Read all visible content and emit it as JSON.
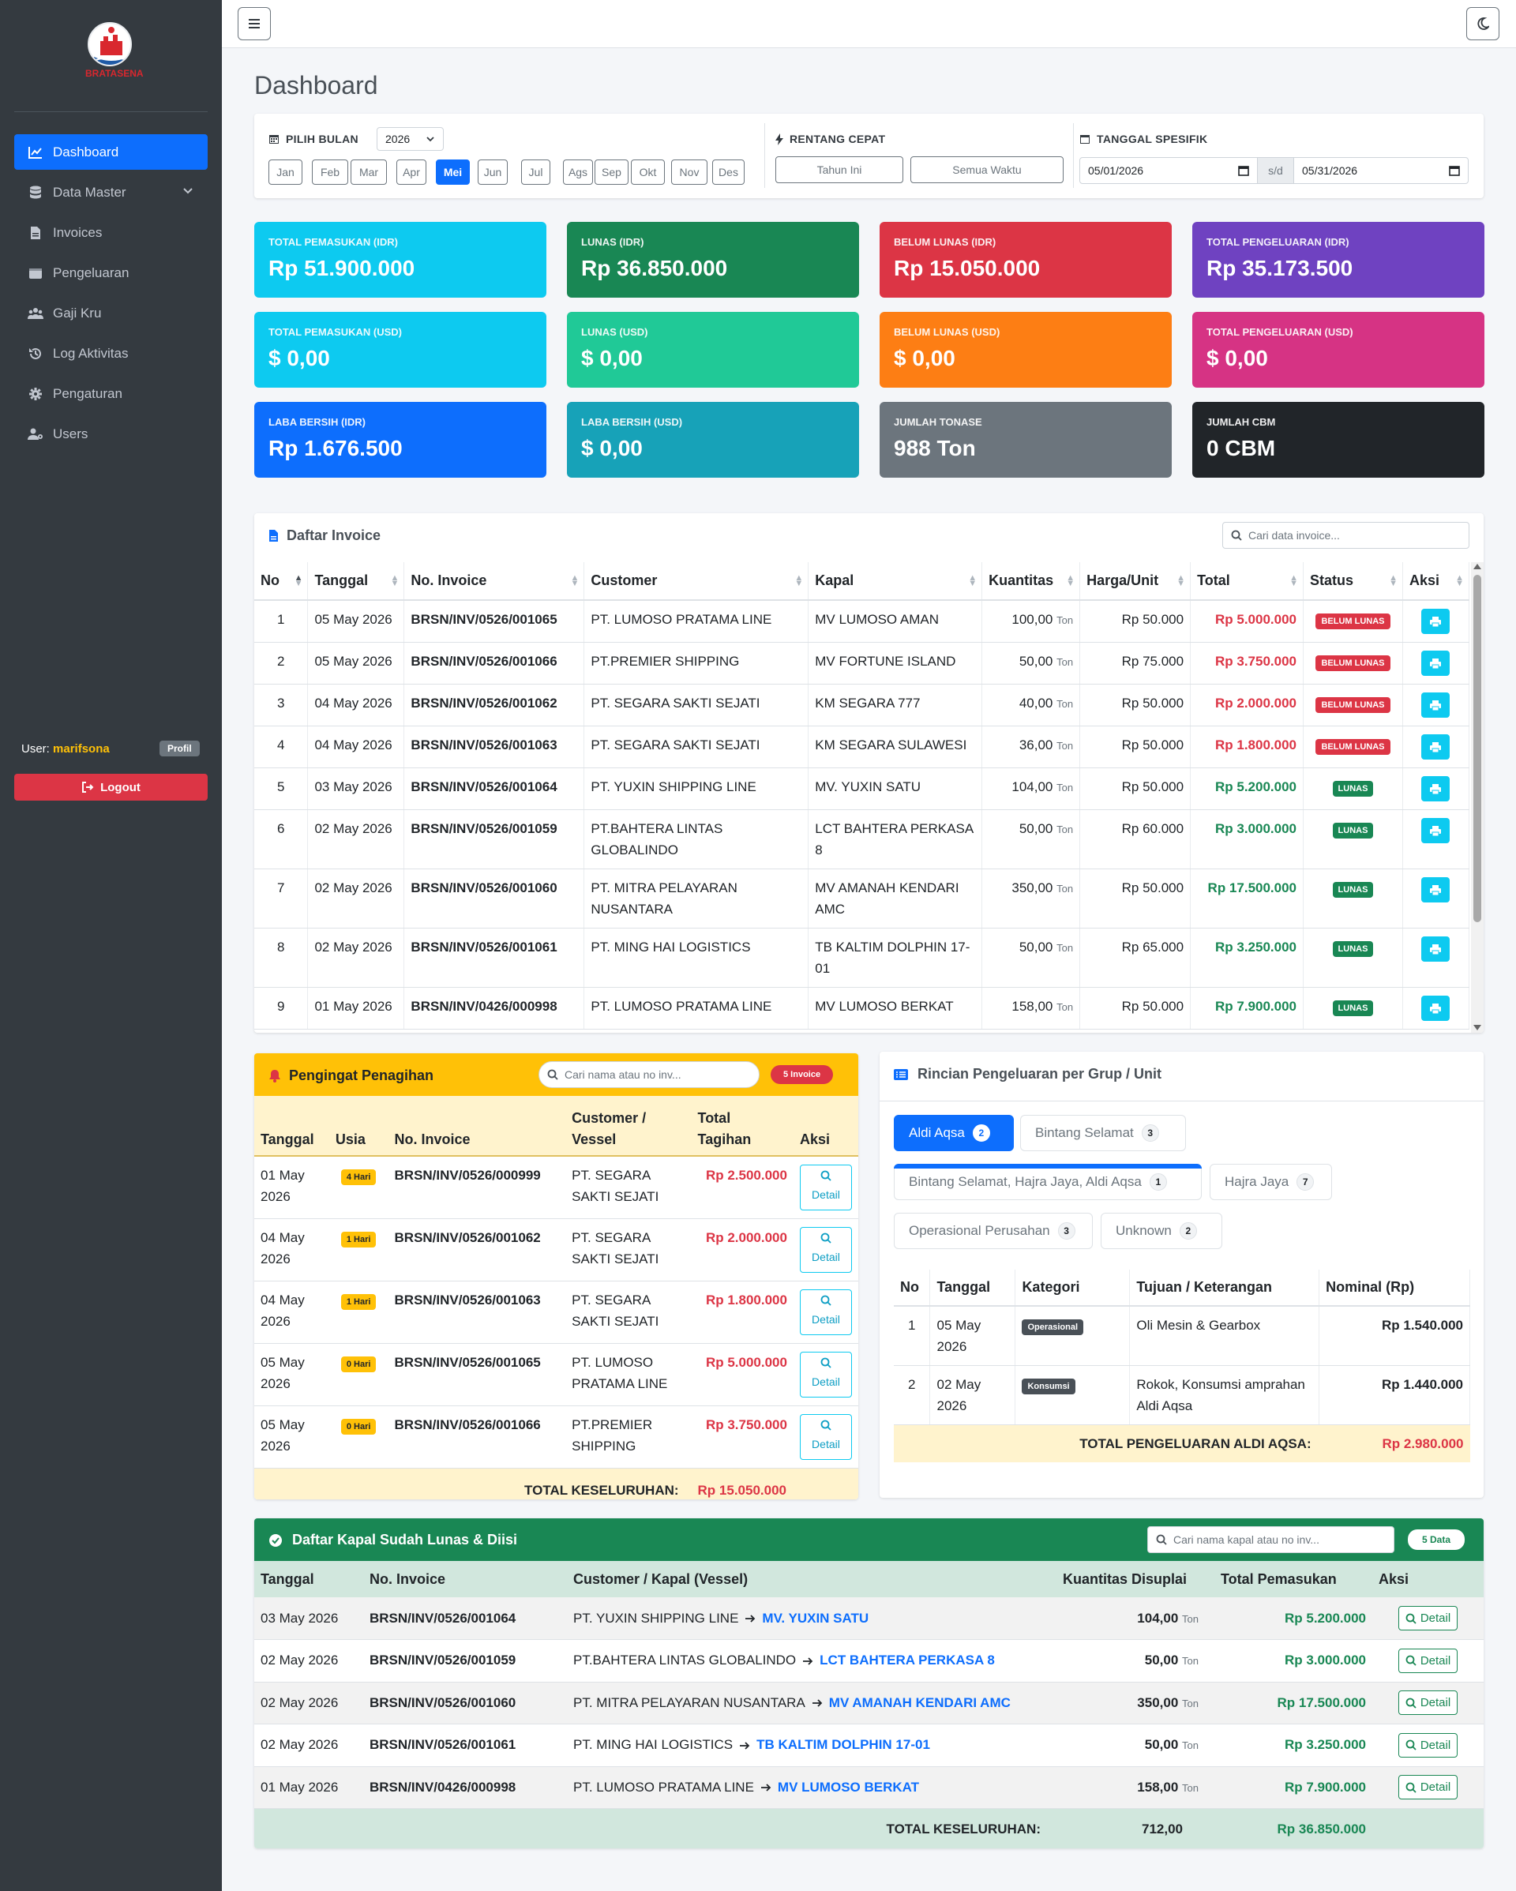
{
  "sidebar": {
    "brand": "BRATASENA",
    "menu": [
      {
        "label": "Dashboard",
        "icon": "chart-line-icon",
        "active": true
      },
      {
        "label": "Data Master",
        "icon": "database-icon",
        "has_children": true
      },
      {
        "label": "Invoices",
        "icon": "file-invoice-icon"
      },
      {
        "label": "Pengeluaran",
        "icon": "wallet-icon"
      },
      {
        "label": "Gaji Kru",
        "icon": "users-icon"
      },
      {
        "label": "Log Aktivitas",
        "icon": "history-icon"
      },
      {
        "label": "Pengaturan",
        "icon": "gear-icon"
      },
      {
        "label": "Users",
        "icon": "user-gear-icon"
      }
    ],
    "user_prefix": "User:",
    "user_name": "marifsona",
    "profile_label": "Profil",
    "logout_label": "Logout"
  },
  "page": {
    "title": "Dashboard"
  },
  "filter": {
    "month_label": "PILIH BULAN",
    "year": "2026",
    "months": [
      "Jan",
      "Feb",
      "Mar",
      "Apr",
      "Mei",
      "Jun",
      "Jul",
      "Ags",
      "Sep",
      "Okt",
      "Nov",
      "Des"
    ],
    "active_month": "Mei",
    "quick_label": "RENTANG CEPAT",
    "quick_this_year": "Tahun Ini",
    "quick_all": "Semua Waktu",
    "date_label": "TANGGAL SPESIFIK",
    "date_from": "05/01/2026",
    "date_sep": "s/d",
    "date_to": "05/31/2026"
  },
  "stats": [
    {
      "label": "TOTAL PEMASUKAN (IDR)",
      "value": "Rp 51.900.000",
      "color": "#0dcaf0"
    },
    {
      "label": "LUNAS (IDR)",
      "value": "Rp 36.850.000",
      "color": "#198754"
    },
    {
      "label": "BELUM LUNAS (IDR)",
      "value": "Rp 15.050.000",
      "color": "#dc3545"
    },
    {
      "label": "TOTAL PENGELUARAN (IDR)",
      "value": "Rp 35.173.500",
      "color": "#6f42c1"
    },
    {
      "label": "TOTAL PEMASUKAN (USD)",
      "value": "$ 0,00",
      "color": "#0dcaf0"
    },
    {
      "label": "LUNAS (USD)",
      "value": "$ 0,00",
      "color": "#20c997"
    },
    {
      "label": "BELUM LUNAS (USD)",
      "value": "$ 0,00",
      "color": "#fd7e14"
    },
    {
      "label": "TOTAL PENGELUARAN (USD)",
      "value": "$ 0,00",
      "color": "#d63384"
    },
    {
      "label": "LABA BERSIH (IDR)",
      "value": "Rp 1.676.500",
      "color": "#0d6efd"
    },
    {
      "label": "LABA BERSIH (USD)",
      "value": "$ 0,00",
      "color": "#17a2b8"
    },
    {
      "label": "JUMLAH TONASE",
      "value": "988 Ton",
      "color": "#6c757d"
    },
    {
      "label": "JUMLAH CBM",
      "value": "0 CBM",
      "color": "#212529"
    }
  ],
  "invoices": {
    "title": "Daftar Invoice",
    "search_placeholder": "Cari data invoice...",
    "columns": [
      "No",
      "Tanggal",
      "No. Invoice",
      "Customer",
      "Kapal",
      "Kuantitas",
      "Harga/Unit",
      "Total",
      "Status",
      "Aksi"
    ],
    "rows": [
      {
        "no": "1",
        "date": "05 May 2026",
        "inv": "BRSN/INV/0526/001065",
        "customer": "PT. LUMOSO PRATAMA LINE",
        "ship": "MV LUMOSO AMAN",
        "qty": "100,00",
        "unit": "Ton",
        "price": "Rp 50.000",
        "total": "Rp 5.000.000",
        "status": "BELUM LUNAS",
        "paid": false
      },
      {
        "no": "2",
        "date": "05 May 2026",
        "inv": "BRSN/INV/0526/001066",
        "customer": "PT.PREMIER SHIPPING",
        "ship": "MV FORTUNE ISLAND",
        "qty": "50,00",
        "unit": "Ton",
        "price": "Rp 75.000",
        "total": "Rp 3.750.000",
        "status": "BELUM LUNAS",
        "paid": false
      },
      {
        "no": "3",
        "date": "04 May 2026",
        "inv": "BRSN/INV/0526/001062",
        "customer": "PT. SEGARA SAKTI SEJATI",
        "ship": "KM SEGARA 777",
        "qty": "40,00",
        "unit": "Ton",
        "price": "Rp 50.000",
        "total": "Rp 2.000.000",
        "status": "BELUM LUNAS",
        "paid": false
      },
      {
        "no": "4",
        "date": "04 May 2026",
        "inv": "BRSN/INV/0526/001063",
        "customer": "PT. SEGARA SAKTI SEJATI",
        "ship": "KM SEGARA SULAWESI",
        "qty": "36,00",
        "unit": "Ton",
        "price": "Rp 50.000",
        "total": "Rp 1.800.000",
        "status": "BELUM LUNAS",
        "paid": false
      },
      {
        "no": "5",
        "date": "03 May 2026",
        "inv": "BRSN/INV/0526/001064",
        "customer": "PT. YUXIN SHIPPING LINE",
        "ship": "MV. YUXIN SATU",
        "qty": "104,00",
        "unit": "Ton",
        "price": "Rp 50.000",
        "total": "Rp 5.200.000",
        "status": "LUNAS",
        "paid": true
      },
      {
        "no": "6",
        "date": "02 May 2026",
        "inv": "BRSN/INV/0526/001059",
        "customer": "PT.BAHTERA LINTAS GLOBALINDO",
        "ship": "LCT BAHTERA PERKASA 8",
        "qty": "50,00",
        "unit": "Ton",
        "price": "Rp 60.000",
        "total": "Rp 3.000.000",
        "status": "LUNAS",
        "paid": true
      },
      {
        "no": "7",
        "date": "02 May 2026",
        "inv": "BRSN/INV/0526/001060",
        "customer": "PT. MITRA PELAYARAN NUSANTARA",
        "ship": "MV AMANAH KENDARI AMC",
        "qty": "350,00",
        "unit": "Ton",
        "price": "Rp 50.000",
        "total": "Rp 17.500.000",
        "status": "LUNAS",
        "paid": true
      },
      {
        "no": "8",
        "date": "02 May 2026",
        "inv": "BRSN/INV/0526/001061",
        "customer": "PT. MING HAI LOGISTICS",
        "ship": "TB KALTIM DOLPHIN 17-01",
        "qty": "50,00",
        "unit": "Ton",
        "price": "Rp 65.000",
        "total": "Rp 3.250.000",
        "status": "LUNAS",
        "paid": true
      },
      {
        "no": "9",
        "date": "01 May 2026",
        "inv": "BRSN/INV/0426/000998",
        "customer": "PT. LUMOSO PRATAMA LINE",
        "ship": "MV LUMOSO BERKAT",
        "qty": "158,00",
        "unit": "Ton",
        "price": "Rp 50.000",
        "total": "Rp 7.900.000",
        "status": "LUNAS",
        "paid": true
      }
    ]
  },
  "reminder": {
    "title": "Pengingat Penagihan",
    "search_placeholder": "Cari nama atau no inv...",
    "count_badge": "5 Invoice",
    "columns": [
      "Tanggal",
      "Usia",
      "No. Invoice",
      "Customer / Vessel",
      "Total Tagihan",
      "Aksi"
    ],
    "rows": [
      {
        "date": "01 May 2026",
        "age": "4 Hari",
        "inv": "BRSN/INV/0526/000999",
        "customer": "PT. SEGARA SAKTI SEJATI",
        "total": "Rp 2.500.000",
        "action": "Detail"
      },
      {
        "date": "04 May 2026",
        "age": "1 Hari",
        "inv": "BRSN/INV/0526/001062",
        "customer": "PT. SEGARA SAKTI SEJATI",
        "total": "Rp 2.000.000",
        "action": "Detail"
      },
      {
        "date": "04 May 2026",
        "age": "1 Hari",
        "inv": "BRSN/INV/0526/001063",
        "customer": "PT. SEGARA SAKTI SEJATI",
        "total": "Rp 1.800.000",
        "action": "Detail"
      },
      {
        "date": "05 May 2026",
        "age": "0 Hari",
        "inv": "BRSN/INV/0526/001065",
        "customer": "PT. LUMOSO PRATAMA LINE",
        "total": "Rp 5.000.000",
        "action": "Detail"
      },
      {
        "date": "05 May 2026",
        "age": "0 Hari",
        "inv": "BRSN/INV/0526/001066",
        "customer": "PT.PREMIER SHIPPING",
        "total": "Rp 3.750.000",
        "action": "Detail"
      }
    ],
    "total_label": "TOTAL KESELURUHAN:",
    "total_value": "Rp 15.050.000"
  },
  "expenses": {
    "title": "Rincian Pengeluaran per Grup / Unit",
    "tabs": [
      {
        "label": "Aldi Aqsa",
        "count": "2",
        "active": true
      },
      {
        "label": "Bintang Selamat",
        "count": "3"
      },
      {
        "label": "Bintang Selamat, Hajra Jaya, Aldi Aqsa",
        "count": "1"
      },
      {
        "label": "Hajra Jaya",
        "count": "7"
      },
      {
        "label": "Operasional Perusahan",
        "count": "3"
      },
      {
        "label": "Unknown",
        "count": "2"
      }
    ],
    "columns": [
      "No",
      "Tanggal",
      "Kategori",
      "Tujuan / Keterangan",
      "Nominal (Rp)"
    ],
    "rows": [
      {
        "no": "1",
        "date": "05 May 2026",
        "category": "Operasional",
        "desc": "Oli Mesin & Gearbox",
        "amount": "Rp 1.540.000"
      },
      {
        "no": "2",
        "date": "02 May 2026",
        "category": "Konsumsi",
        "desc": "Rokok, Konsumsi amprahan Aldi Aqsa",
        "amount": "Rp 1.440.000"
      }
    ],
    "total_label": "TOTAL PENGELUARAN ALDI AQSA:",
    "total_value": "Rp 2.980.000"
  },
  "paid_ships": {
    "title": "Daftar Kapal Sudah Lunas & Diisi",
    "search_placeholder": "Cari nama kapal atau no inv...",
    "count_badge": "5 Data",
    "columns": [
      "Tanggal",
      "No. Invoice",
      "Customer / Kapal (Vessel)",
      "Kuantitas Disuplai",
      "Total Pemasukan",
      "Aksi"
    ],
    "rows": [
      {
        "date": "03 May 2026",
        "inv": "BRSN/INV/0526/001064",
        "customer": "PT. YUXIN SHIPPING LINE",
        "vessel": "MV. YUXIN SATU",
        "qty": "104,00",
        "unit": "Ton",
        "total": "Rp 5.200.000",
        "action": "Detail"
      },
      {
        "date": "02 May 2026",
        "inv": "BRSN/INV/0526/001059",
        "customer": "PT.BAHTERA LINTAS GLOBALINDO",
        "vessel": "LCT BAHTERA PERKASA 8",
        "qty": "50,00",
        "unit": "Ton",
        "total": "Rp 3.000.000",
        "action": "Detail"
      },
      {
        "date": "02 May 2026",
        "inv": "BRSN/INV/0526/001060",
        "customer": "PT. MITRA PELAYARAN NUSANTARA",
        "vessel": "MV AMANAH KENDARI AMC",
        "qty": "350,00",
        "unit": "Ton",
        "total": "Rp 17.500.000",
        "action": "Detail"
      },
      {
        "date": "02 May 2026",
        "inv": "BRSN/INV/0526/001061",
        "customer": "PT. MING HAI LOGISTICS",
        "vessel": "TB KALTIM DOLPHIN 17-01",
        "qty": "50,00",
        "unit": "Ton",
        "total": "Rp 3.250.000",
        "action": "Detail"
      },
      {
        "date": "01 May 2026",
        "inv": "BRSN/INV/0426/000998",
        "customer": "PT. LUMOSO PRATAMA LINE",
        "vessel": "MV LUMOSO BERKAT",
        "qty": "158,00",
        "unit": "Ton",
        "total": "Rp 7.900.000",
        "action": "Detail"
      }
    ],
    "total_label": "TOTAL KESELURUHAN:",
    "total_qty": "712,00",
    "total_value": "Rp 36.850.000"
  }
}
